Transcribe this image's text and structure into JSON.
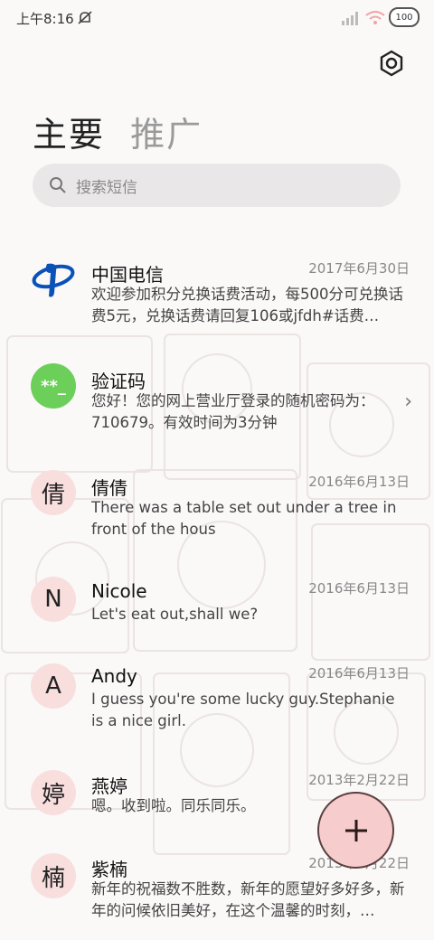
{
  "status_bar": {
    "time": "上午8:16",
    "battery": "100",
    "icons": [
      "mute-bell-icon",
      "signal-icon",
      "wifi-icon",
      "battery-icon"
    ]
  },
  "header": {
    "settings_icon": "gear-icon",
    "tabs": [
      {
        "label": "主要",
        "active": true
      },
      {
        "label": "推广",
        "active": false
      }
    ]
  },
  "search": {
    "placeholder": "搜索短信",
    "icon": "search-icon"
  },
  "conversations": [
    {
      "avatar": "telecom-logo",
      "name": "中国电信",
      "date": "2017年6月30日",
      "snippet": "欢迎参加积分兑换话费活动，每500分可兑换话费5元，兑换话费请回复106或jfdh#话费…"
    },
    {
      "avatar": "**_",
      "name": "验证码",
      "date": "",
      "snippet": "您好！您的网上营业厅登录的随机密码为：710679。有效时间为3分钟"
    },
    {
      "avatar": "倩",
      "name": "倩倩",
      "date": "2016年6月13日",
      "snippet": "There was a table set out under a tree in front of the hous"
    },
    {
      "avatar": "N",
      "name": "Nicole",
      "date": "2016年6月13日",
      "snippet": "Let's eat out,shall we?"
    },
    {
      "avatar": "A",
      "name": "Andy",
      "date": "2016年6月13日",
      "snippet": "I guess you're some lucky guy.Stephanie is a nice girl."
    },
    {
      "avatar": "婷",
      "name": "燕婷",
      "date": "2013年2月22日",
      "snippet": "嗯。收到啦。同乐同乐。"
    },
    {
      "avatar": "楠",
      "name": "紫楠",
      "date": "2013年2月22日",
      "snippet": "新年的祝福数不胜数，新年的愿望好多好多，新年的问候依旧美好，在这个温馨的时刻，…"
    }
  ],
  "fab": {
    "icon": "plus-icon"
  },
  "colors": {
    "avatar_bg": "#f9dede",
    "verification_avatar": "#6ccf5a",
    "telecom_blue": "#0a52b8",
    "fab_bg": "#f7cccc"
  }
}
